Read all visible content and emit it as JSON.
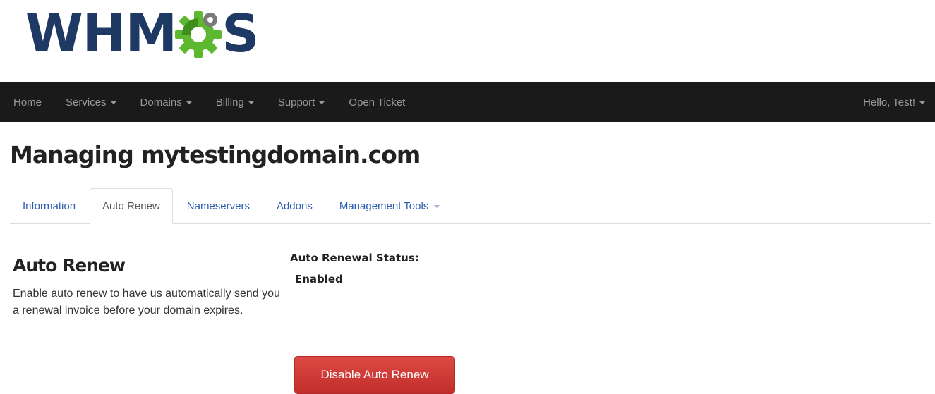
{
  "brand": {
    "logo_text_left": "WHM",
    "logo_text_right": "S",
    "logo_icon": "gear-icon",
    "colors": {
      "navy": "#1e3a64",
      "gear_green": "#5cb82f",
      "gear_dark": "#3f8e1c"
    }
  },
  "navbar": {
    "items": [
      {
        "label": "Home",
        "dropdown": false
      },
      {
        "label": "Services",
        "dropdown": true
      },
      {
        "label": "Domains",
        "dropdown": true
      },
      {
        "label": "Billing",
        "dropdown": true
      },
      {
        "label": "Support",
        "dropdown": true
      },
      {
        "label": "Open Ticket",
        "dropdown": false
      }
    ],
    "user_menu": "Hello, Test!",
    "colors": {
      "background": "#1a1a1a",
      "text": "#9a9a9a"
    }
  },
  "page": {
    "title": "Managing mytestingdomain.com"
  },
  "tabs": [
    {
      "label": "Information",
      "active": false
    },
    {
      "label": "Auto Renew",
      "active": true
    },
    {
      "label": "Nameservers",
      "active": false
    },
    {
      "label": "Addons",
      "active": false
    },
    {
      "label": "Management Tools",
      "active": false,
      "dropdown": true
    }
  ],
  "auto_renew": {
    "heading": "Auto Renew",
    "description": "Enable auto renew to have us automatically send you a renewal invoice before your domain expires.",
    "status_label": "Auto Renewal Status:",
    "status_value": "Enabled",
    "button_label": "Disable Auto Renew",
    "button_color": "#c9302c"
  }
}
